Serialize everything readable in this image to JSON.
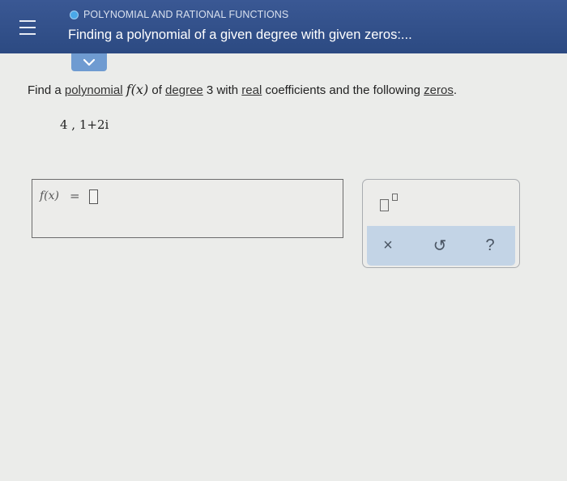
{
  "header": {
    "topic": "POLYNOMIAL AND RATIONAL FUNCTIONS",
    "title": "Finding a polynomial of a given degree with given zeros:..."
  },
  "icons": {
    "menu": "hamburger-menu-icon",
    "collapse": "chevron-down-icon",
    "exponent": "exponent-template-icon",
    "clear": "x-icon",
    "undo": "undo-icon",
    "help": "question-mark-icon"
  },
  "question": {
    "part1": "Find a ",
    "link_polynomial": "polynomial",
    "function_notation": "f(x)",
    "part2": " of ",
    "link_degree": "degree",
    "degree_value": " 3 ",
    "part3": "with ",
    "link_real": "real",
    "part4": " coefficients and the following ",
    "link_zeros": "zeros",
    "part5": "."
  },
  "zeros": "4 ,  1+2i",
  "answer": {
    "label": "f(x)",
    "equals": "="
  },
  "tools": {
    "clear": "×",
    "undo": "↺",
    "help": "?"
  },
  "colors": {
    "header_bg": "#2f4d85",
    "topic_dot": "#4aa8e8",
    "collapse_button": "#6f9bd1",
    "tool_bar": "#c3d4e6"
  }
}
